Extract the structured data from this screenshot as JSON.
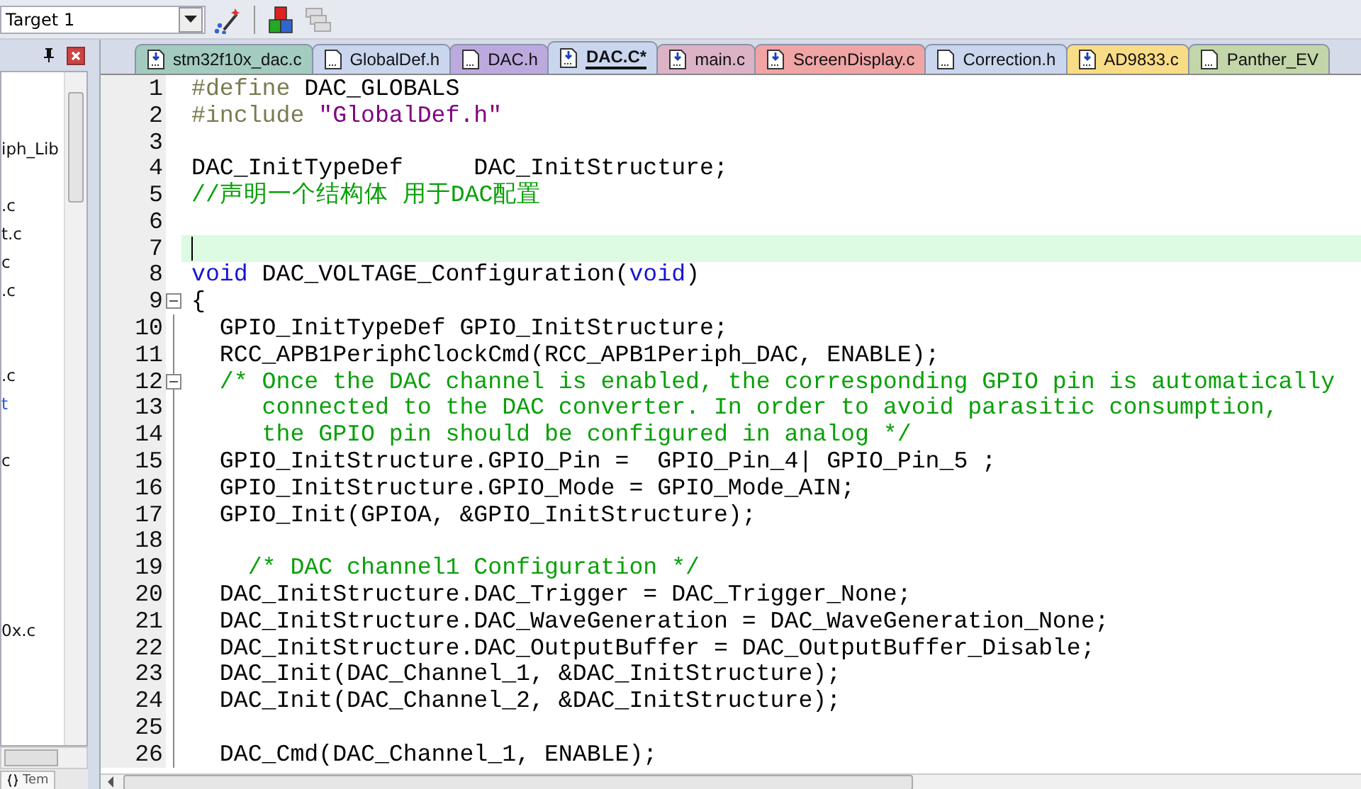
{
  "toolbar": {
    "target": "Target 1"
  },
  "project_panel": {
    "items": [
      {
        "text": "iph_Lib",
        "selected": false
      },
      {
        "text": ".c",
        "selected": false
      },
      {
        "text": "t.c",
        "selected": false
      },
      {
        "text": "c",
        "selected": false
      },
      {
        "text": ".c",
        "selected": false
      },
      {
        "text": ".c",
        "selected": false
      },
      {
        "text": "t",
        "selected": true
      },
      {
        "text": "c",
        "selected": false
      },
      {
        "text": "0x.c",
        "selected": false
      }
    ],
    "bottom_tab": "Tem"
  },
  "tabs": [
    {
      "label": "stm32f10x_dac.c",
      "kind": "source",
      "color": "#a3cbbf",
      "selected": false
    },
    {
      "label": "GlobalDef.h",
      "kind": "header",
      "color": "#c9d6ee",
      "selected": false
    },
    {
      "label": "DAC.h",
      "kind": "header",
      "color": "#bcaade",
      "selected": false
    },
    {
      "label": "DAC.C*",
      "kind": "source",
      "color": "#c9d6ee",
      "selected": true
    },
    {
      "label": "main.c",
      "kind": "source",
      "color": "#dcb3c6",
      "selected": false
    },
    {
      "label": "ScreenDisplay.c",
      "kind": "source",
      "color": "#f0a4a4",
      "selected": false
    },
    {
      "label": "Correction.h",
      "kind": "header",
      "color": "#c9d6ee",
      "selected": false
    },
    {
      "label": "AD9833.c",
      "kind": "source",
      "color": "#f9dc86",
      "selected": false
    },
    {
      "label": "Panther_EV",
      "kind": "header",
      "color": "#c3d6aa",
      "selected": false
    }
  ],
  "editor": {
    "lines": [
      {
        "number": "1",
        "fold": false,
        "current": false,
        "tokens": [
          {
            "kind": "pre",
            "text": "#define"
          },
          {
            "kind": "plain",
            "text": " DAC_GLOBALS"
          }
        ]
      },
      {
        "number": "2",
        "fold": false,
        "current": false,
        "tokens": [
          {
            "kind": "pre",
            "text": "#include"
          },
          {
            "kind": "str",
            "text": " \"GlobalDef.h\""
          }
        ]
      },
      {
        "number": "3",
        "fold": false,
        "current": false
      },
      {
        "number": "4",
        "fold": false,
        "current": false,
        "tokens": [
          {
            "kind": "plain",
            "text": "DAC_InitTypeDef     DAC_InitStructure;"
          }
        ]
      },
      {
        "number": "5",
        "fold": false,
        "current": false,
        "tokens": [
          {
            "kind": "cmt",
            "text": "//声明一个结构体 用于DAC配置"
          }
        ]
      },
      {
        "number": "6",
        "fold": false,
        "current": false
      },
      {
        "number": "7",
        "fold": false,
        "current": true
      },
      {
        "number": "8",
        "fold": false,
        "current": false,
        "tokens": [
          {
            "kind": "kw",
            "text": "void"
          },
          {
            "kind": "plain",
            "text": " DAC_VOLTAGE_Configuration("
          },
          {
            "kind": "kw",
            "text": "void"
          },
          {
            "kind": "plain",
            "text": ")"
          }
        ]
      },
      {
        "number": "9",
        "fold": true,
        "current": false,
        "tokens": [
          {
            "kind": "plain",
            "text": "{"
          }
        ]
      },
      {
        "number": "10",
        "fold": false,
        "current": false,
        "tokens": [
          {
            "kind": "plain",
            "text": "  GPIO_InitTypeDef GPIO_InitStructure;"
          }
        ]
      },
      {
        "number": "11",
        "fold": false,
        "current": false,
        "tokens": [
          {
            "kind": "plain",
            "text": "  RCC_APB1PeriphClockCmd(RCC_APB1Periph_DAC, ENABLE);"
          }
        ]
      },
      {
        "number": "12",
        "fold": true,
        "current": false,
        "tokens": [
          {
            "kind": "cmt",
            "text": "  /* Once the DAC channel is enabled, the corresponding GPIO pin is automatically"
          }
        ]
      },
      {
        "number": "13",
        "fold": false,
        "current": false,
        "tokens": [
          {
            "kind": "cmt",
            "text": "     connected to the DAC converter. In order to avoid parasitic consumption,"
          }
        ]
      },
      {
        "number": "14",
        "fold": false,
        "current": false,
        "tokens": [
          {
            "kind": "cmt",
            "text": "     the GPIO pin should be configured in analog */"
          }
        ]
      },
      {
        "number": "15",
        "fold": false,
        "current": false,
        "tokens": [
          {
            "kind": "plain",
            "text": "  GPIO_InitStructure.GPIO_Pin =  GPIO_Pin_4| GPIO_Pin_5 ;"
          }
        ]
      },
      {
        "number": "16",
        "fold": false,
        "current": false,
        "tokens": [
          {
            "kind": "plain",
            "text": "  GPIO_InitStructure.GPIO_Mode = GPIO_Mode_AIN;"
          }
        ]
      },
      {
        "number": "17",
        "fold": false,
        "current": false,
        "tokens": [
          {
            "kind": "plain",
            "text": "  GPIO_Init(GPIOA, &GPIO_InitStructure);"
          }
        ]
      },
      {
        "number": "18",
        "fold": false,
        "current": false
      },
      {
        "number": "19",
        "fold": false,
        "current": false,
        "tokens": [
          {
            "kind": "cmt",
            "text": "    /* DAC channel1 Configuration */"
          }
        ]
      },
      {
        "number": "20",
        "fold": false,
        "current": false,
        "tokens": [
          {
            "kind": "plain",
            "text": "  DAC_InitStructure.DAC_Trigger = DAC_Trigger_None;"
          }
        ]
      },
      {
        "number": "21",
        "fold": false,
        "current": false,
        "tokens": [
          {
            "kind": "plain",
            "text": "  DAC_InitStructure.DAC_WaveGeneration = DAC_WaveGeneration_None;"
          }
        ]
      },
      {
        "number": "22",
        "fold": false,
        "current": false,
        "tokens": [
          {
            "kind": "plain",
            "text": "  DAC_InitStructure.DAC_OutputBuffer = DAC_OutputBuffer_Disable;"
          }
        ]
      },
      {
        "number": "23",
        "fold": false,
        "current": false,
        "tokens": [
          {
            "kind": "plain",
            "text": "  DAC_Init(DAC_Channel_1, &DAC_InitStructure);"
          }
        ]
      },
      {
        "number": "24",
        "fold": false,
        "current": false,
        "tokens": [
          {
            "kind": "plain",
            "text": "  DAC_Init(DAC_Channel_2, &DAC_InitStructure);"
          }
        ]
      },
      {
        "number": "25",
        "fold": false,
        "current": false
      },
      {
        "number": "26",
        "fold": false,
        "current": false,
        "tokens": [
          {
            "kind": "plain",
            "text": "  DAC_Cmd(DAC_Channel_1, ENABLE);"
          }
        ]
      }
    ]
  }
}
